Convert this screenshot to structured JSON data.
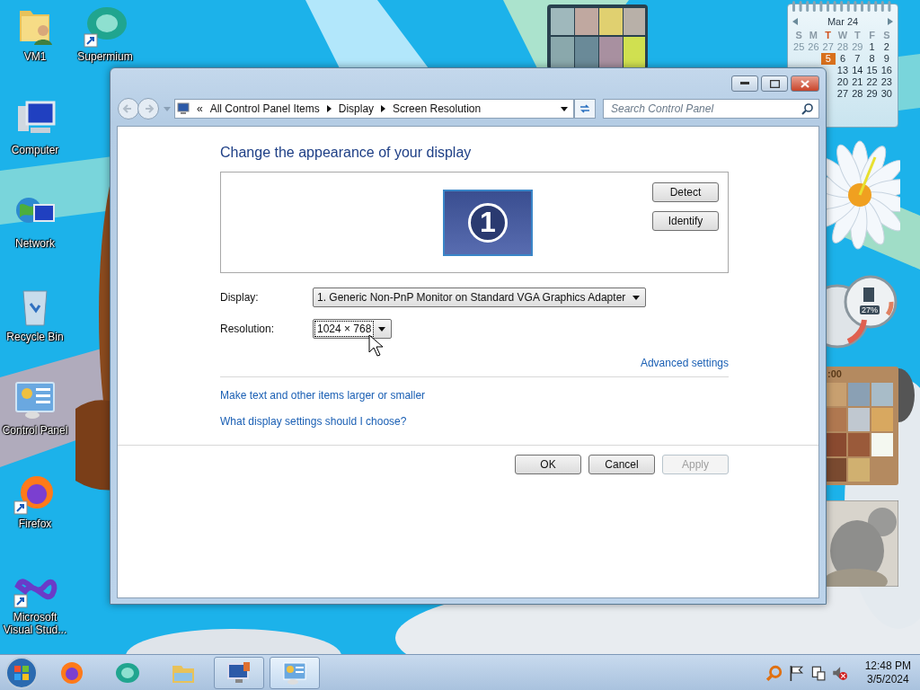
{
  "wallpaper": {
    "kind": "picture"
  },
  "desktop_icons": [
    [
      {
        "label": "VM1",
        "kind": "user-folder",
        "shortcut": false
      },
      {
        "label": "Computer",
        "kind": "computer",
        "shortcut": false
      },
      {
        "label": "Network",
        "kind": "network",
        "shortcut": false
      },
      {
        "label": "Recycle Bin",
        "kind": "recycle",
        "shortcut": false
      },
      {
        "label": "Control Panel",
        "kind": "control-panel",
        "shortcut": false
      },
      {
        "label": "Firefox",
        "kind": "firefox",
        "shortcut": true
      },
      {
        "label": "Microsoft Visual Stud...",
        "kind": "visual-studio",
        "shortcut": true
      }
    ],
    [
      {
        "label": "Supermium",
        "kind": "supermium",
        "shortcut": true
      }
    ]
  ],
  "gadgets": {
    "slideshow": {
      "kind": "picture"
    },
    "calendar": {
      "month": "Mar 24",
      "weekdays": [
        {
          "label": "S",
          "today": false
        },
        {
          "label": "M",
          "today": false
        },
        {
          "label": "T",
          "today": true
        },
        {
          "label": "W",
          "today": false
        },
        {
          "label": "T",
          "today": false
        },
        {
          "label": "F",
          "today": false
        },
        {
          "label": "S",
          "today": false
        }
      ],
      "weeks": [
        [
          {
            "day": "25",
            "faded": true,
            "selected": false
          },
          {
            "day": "26",
            "faded": true,
            "selected": false
          },
          {
            "day": "27",
            "faded": true,
            "selected": false
          },
          {
            "day": "28",
            "faded": true,
            "selected": false
          },
          {
            "day": "29",
            "faded": true,
            "selected": false
          },
          {
            "day": "1",
            "faded": false,
            "selected": false
          },
          {
            "day": "2",
            "faded": false,
            "selected": false
          }
        ],
        [
          {
            "day": "5",
            "faded": false,
            "selected": true
          },
          {
            "day": "6",
            "faded": false,
            "selected": false
          },
          {
            "day": "7",
            "faded": false,
            "selected": false
          },
          {
            "day": "8",
            "faded": false,
            "selected": false
          },
          {
            "day": "9",
            "faded": false,
            "selected": false
          }
        ],
        [
          {
            "day": "13",
            "faded": false,
            "selected": false
          },
          {
            "day": "14",
            "faded": false,
            "selected": false
          },
          {
            "day": "15",
            "faded": false,
            "selected": false
          },
          {
            "day": "16",
            "faded": false,
            "selected": false
          }
        ],
        [
          {
            "day": "20",
            "faded": false,
            "selected": false
          },
          {
            "day": "21",
            "faded": false,
            "selected": false
          },
          {
            "day": "22",
            "faded": false,
            "selected": false
          },
          {
            "day": "23",
            "faded": false,
            "selected": false
          }
        ],
        [
          {
            "day": "27",
            "faded": false,
            "selected": false
          },
          {
            "day": "28",
            "faded": false,
            "selected": false
          },
          {
            "day": "29",
            "faded": false,
            "selected": false
          },
          {
            "day": "30",
            "faded": false,
            "selected": false
          }
        ]
      ]
    },
    "cpu_meter": {
      "reading": "27%"
    },
    "puzzle": {
      "time": ":00"
    },
    "koala": {
      "kind": "picture"
    }
  },
  "window": {
    "address": {
      "crumbs": [
        "All Control Panel Items",
        "Display",
        "Screen Resolution"
      ],
      "overflow": "«"
    },
    "search": {
      "placeholder": "Search Control Panel"
    },
    "heading": "Change the appearance of your display",
    "preview": {
      "monitor_number": "1",
      "buttons": [
        "Detect",
        "Identify"
      ]
    },
    "fields": [
      {
        "label": "Display:",
        "value": "1. Generic Non-PnP Monitor on Standard VGA Graphics Adapter",
        "focused": false
      },
      {
        "label": "Resolution:",
        "value": "1024 × 768",
        "focused": true
      }
    ],
    "advanced_link": "Advanced settings",
    "links": [
      "Make text and other items larger or smaller",
      "What display settings should I choose?"
    ],
    "buttons": [
      {
        "label": "OK",
        "disabled": false
      },
      {
        "label": "Cancel",
        "disabled": false
      },
      {
        "label": "Apply",
        "disabled": true
      }
    ]
  },
  "taskbar": {
    "items": [
      {
        "kind": "firefox",
        "open": false,
        "selected": false
      },
      {
        "kind": "supermium",
        "open": false,
        "selected": false
      },
      {
        "kind": "explorer",
        "open": false,
        "selected": false
      },
      {
        "kind": "display",
        "open": true,
        "selected": false
      },
      {
        "kind": "control-panel",
        "open": true,
        "selected": true
      }
    ],
    "tray": [
      {
        "kind": "search"
      },
      {
        "kind": "flag"
      },
      {
        "kind": "network"
      },
      {
        "kind": "volume-muted"
      }
    ],
    "time": "12:48 PM",
    "date": "3/5/2024"
  }
}
